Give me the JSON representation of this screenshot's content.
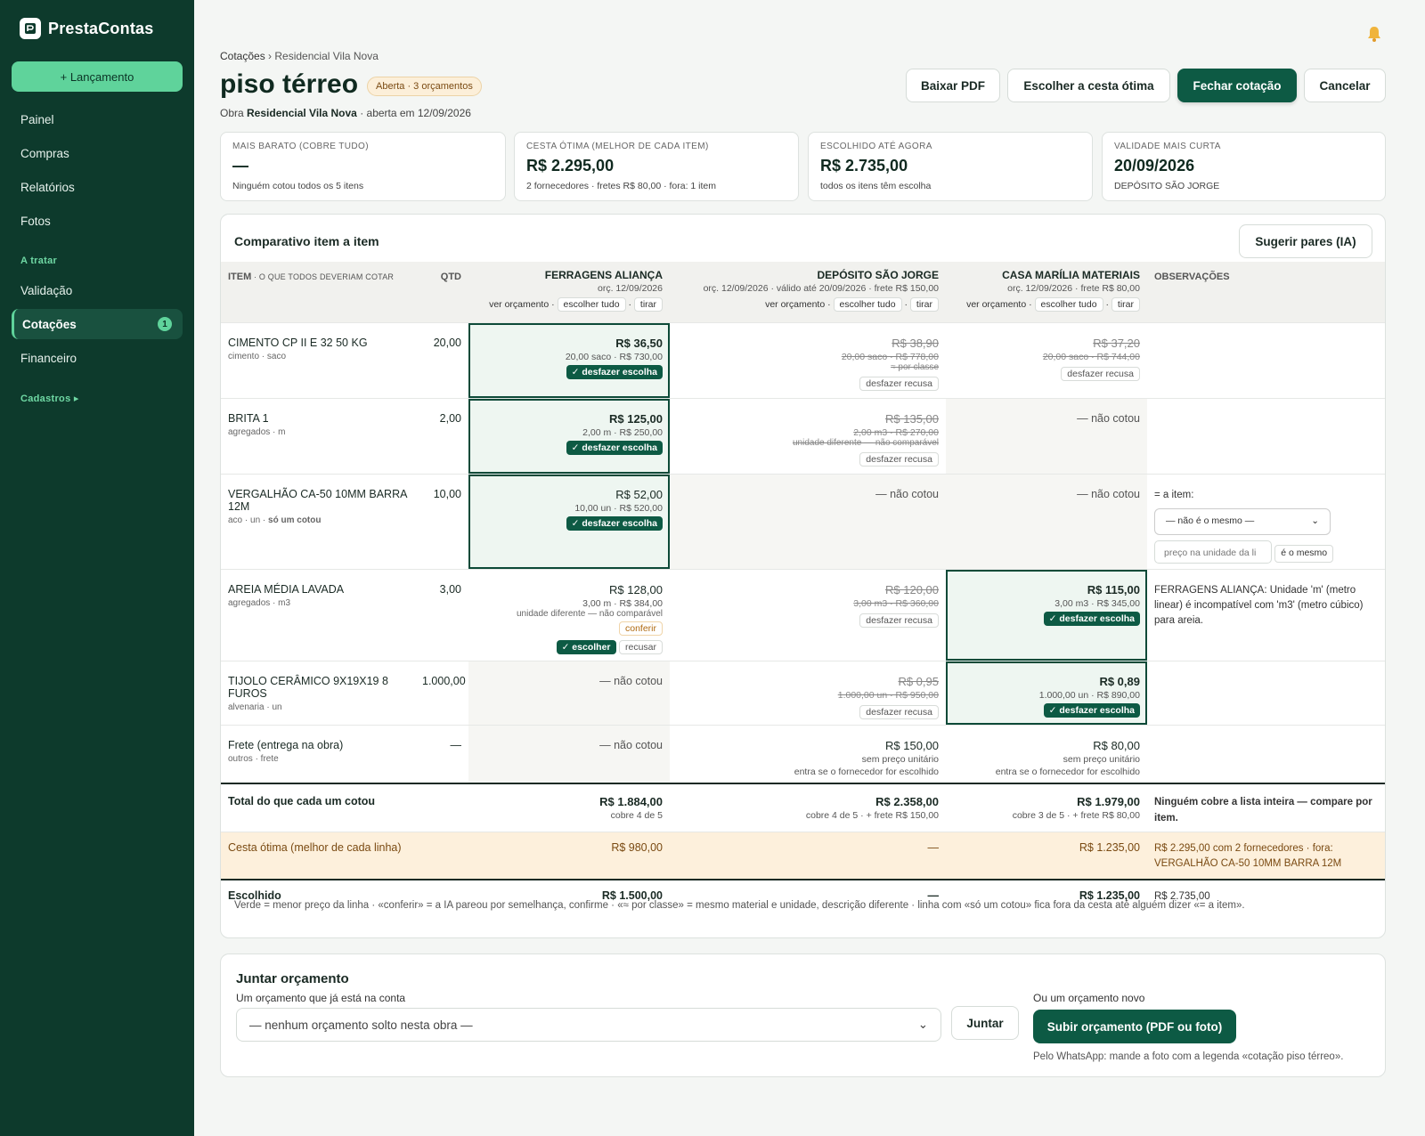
{
  "app": {
    "name": "PrestaContas",
    "launch": "+ Lançamento"
  },
  "nav": {
    "painel": "Painel",
    "compras": "Compras",
    "relatorios": "Relatórios",
    "fotos": "Fotos",
    "sec_tratar": "A tratar",
    "validacao": "Validação",
    "cotacoes": "Cotações",
    "cotacoes_count": "1",
    "financeiro": "Financeiro",
    "sec_cadastros": "Cadastros ▸"
  },
  "crumb": {
    "root": "Cotações",
    "sep": " › ",
    "current": "Residencial Vila Nova"
  },
  "header": {
    "title": "piso térreo",
    "badge": "Aberta · 3 orçamentos",
    "sub_prefix": "Obra ",
    "sub_obra": "Residencial Vila Nova",
    "sub_suffix": " · aberta em 12/09/2026"
  },
  "actions": {
    "pdf": "Baixar PDF",
    "cesta": "Escolher a cesta ótima",
    "fechar": "Fechar cotação",
    "cancelar": "Cancelar"
  },
  "cards": [
    {
      "k": "MAIS BARATO (COBRE TUDO)",
      "v": "—",
      "s": "Ninguém cotou todos os 5 itens"
    },
    {
      "k": "CESTA ÓTIMA (MELHOR DE CADA ITEM)",
      "v": "R$ 2.295,00",
      "s": "2 fornecedores · fretes R$ 80,00 · fora: 1 item"
    },
    {
      "k": "ESCOLHIDO ATÉ AGORA",
      "v": "R$ 2.735,00",
      "s": "todos os itens têm escolha"
    },
    {
      "k": "VALIDADE MAIS CURTA",
      "v": "20/09/2026",
      "s": "DEPÓSITO SÃO JORGE"
    }
  ],
  "panel": {
    "title": "Comparativo item a item",
    "suggest": "Sugerir pares (IA)"
  },
  "th": {
    "item": "ITEM",
    "item_sub": " · O QUE TODOS DEVERIAM COTAR",
    "qtd": "QTD",
    "obs": "OBSERVAÇÕES"
  },
  "suppliers": [
    {
      "name": "FERRAGENS ALIANÇA",
      "meta": "orç. 12/09/2026",
      "ver": "ver orçamento ·",
      "all": "escolher tudo",
      "dot": "·",
      "tirar": "tirar"
    },
    {
      "name": "DEPÓSITO SÃO JORGE",
      "meta": "orç. 12/09/2026 · válido até 20/09/2026 · frete R$ 150,00",
      "ver": "ver orçamento ·",
      "all": "escolher tudo",
      "dot": "·",
      "tirar": "tirar"
    },
    {
      "name": "CASA MARÍLIA MATERIAIS",
      "meta": "orç. 12/09/2026 · frete R$ 80,00",
      "ver": "ver orçamento ·",
      "all": "escolher tudo",
      "dot": "·",
      "tirar": "tirar"
    }
  ],
  "labels": {
    "undo": "✓ desfazer escolha",
    "undo_refuse": "desfazer recusa",
    "not_quoted": "— não cotou",
    "choose": "✓ escolher",
    "refuse": "recusar",
    "confirm": "conferir",
    "no_unit": "sem preço unitário",
    "enters": "entra se o fornecedor for escolhido"
  },
  "rows": [
    {
      "name": "CIMENTO CP II E 32 50 KG",
      "sub": "cimento · saco",
      "qtd": "20,00",
      "a": {
        "p": "R$ 36,50",
        "d": "20,00 saco · R$ 730,00"
      },
      "b": {
        "p": "R$ 38,90",
        "d": "20,00 saco · R$ 778,00",
        "x": "≈ por classe"
      },
      "c": {
        "p": "R$ 37,20",
        "d": "20,00 saco · R$ 744,00"
      }
    },
    {
      "name": "BRITA 1",
      "sub": "agregados · m",
      "qtd": "2,00",
      "a": {
        "p": "R$ 125,00",
        "d": "2,00 m · R$ 250,00"
      },
      "b": {
        "p": "R$ 135,00",
        "d": "2,00 m3 · R$ 270,00",
        "x": "unidade diferente — não comparável"
      }
    },
    {
      "name": "VERGALHÃO CA-50 10MM BARRA 12M",
      "sub": "aco · un · ",
      "sub_b": "só um cotou",
      "qtd": "10,00",
      "a": {
        "p": "R$ 52,00",
        "d": "10,00 un · R$ 520,00"
      },
      "obs_label": "= a item:",
      "obs_select": "— não é o mesmo —",
      "obs_input": "preço na unidade da li",
      "obs_btn": "é o mesmo"
    },
    {
      "name": "AREIA MÉDIA LAVADA",
      "sub": "agregados · m3",
      "qtd": "3,00",
      "a": {
        "p": "R$ 128,00",
        "d": "3,00 m · R$ 384,00",
        "x": "unidade diferente — não comparável"
      },
      "b": {
        "p": "R$ 120,00",
        "d": "3,00 m3 · R$ 360,00"
      },
      "c": {
        "p": "R$ 115,00",
        "d": "3,00 m3 · R$ 345,00"
      },
      "obs": "FERRAGENS ALIANÇA: Unidade 'm' (metro linear) é incompatível com 'm3' (metro cúbico) para areia."
    },
    {
      "name": "TIJOLO CERÂMICO 9X19X19 8 FUROS",
      "sub": "alvenaria · un",
      "qtd": "1.000,00",
      "b": {
        "p": "R$ 0,95",
        "d": "1.000,00 un · R$ 950,00"
      },
      "c": {
        "p": "R$ 0,89",
        "d": "1.000,00 un · R$ 890,00"
      }
    },
    {
      "name": "Frete (entrega na obra)",
      "sub": "outros · frete",
      "qtd": "—",
      "b": {
        "p": "R$ 150,00"
      },
      "c": {
        "p": "R$ 80,00"
      }
    }
  ],
  "totals": {
    "label": "Total do que cada um cotou",
    "a": "R$ 1.884,00",
    "a_s": "cobre 4 de 5",
    "b": "R$ 2.358,00",
    "b_s": "cobre 4 de 5 · + frete R$ 150,00",
    "c": "R$ 1.979,00",
    "c_s": "cobre 3 de 5 · + frete R$ 80,00",
    "obs": "Ninguém cobre a lista inteira — compare por item."
  },
  "best": {
    "label": "Cesta ótima (melhor de cada linha)",
    "a": "R$ 980,00",
    "b": "—",
    "c": "R$ 1.235,00",
    "obs": "R$ 2.295,00 com 2 fornecedores · fora: VERGALHÃO CA-50 10MM BARRA 12M"
  },
  "chosen": {
    "label": "Escolhido",
    "a": "R$ 1.500,00",
    "b": "—",
    "c": "R$ 1.235,00",
    "obs": "R$ 2.735,00"
  },
  "legend": "Verde = menor preço da linha · «conferir» = a IA pareou por semelhança, confirme · «≈ por classe» = mesmo material e unidade, descrição diferente · linha com «só um cotou» fica fora da cesta até alguém dizer «= a item».",
  "join": {
    "title": "Juntar orçamento",
    "label": "Um orçamento que já está na conta",
    "select": "— nenhum orçamento solto nesta obra —",
    "btn": "Juntar",
    "or": "Ou um orçamento novo",
    "upload": "Subir orçamento (PDF ou foto)",
    "wa": "Pelo WhatsApp: mande a foto com a legenda «cotação piso térreo»."
  }
}
